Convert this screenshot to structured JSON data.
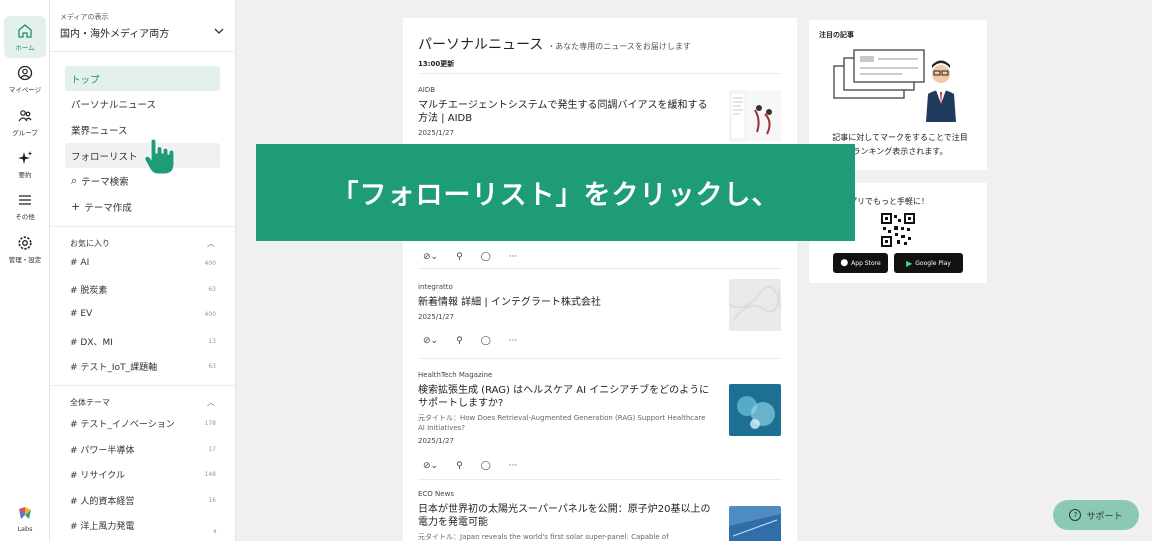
{
  "rail": {
    "items": [
      {
        "label": "ホーム",
        "icon": "home-icon"
      },
      {
        "label": "マイページ",
        "icon": "user-icon"
      },
      {
        "label": "グループ",
        "icon": "group-icon"
      },
      {
        "label": "要約",
        "icon": "sparkle-icon"
      },
      {
        "label": "その他",
        "icon": "menu-icon"
      },
      {
        "label": "管理・設定",
        "icon": "gear-icon"
      }
    ],
    "labs_label": "Labs"
  },
  "sidebar": {
    "media_caption": "メディアの表示",
    "media_value": "国内・海外メディア両方",
    "nav": [
      {
        "label": "トップ"
      },
      {
        "label": "パーソナルニュース"
      },
      {
        "label": "業界ニュース"
      },
      {
        "label": "フォローリスト"
      },
      {
        "label": "テーマ検索"
      },
      {
        "label": "テーマ作成"
      }
    ],
    "favorites_title": "お気に入り",
    "favorites": [
      {
        "name": "AI",
        "count": "400"
      },
      {
        "name": "脱炭素",
        "count": "63"
      },
      {
        "name": "EV",
        "count": "400"
      },
      {
        "name": "DX、MI",
        "count": "13"
      },
      {
        "name": "テスト_IoT_課題軸",
        "count": "63"
      }
    ],
    "themes_title": "全体テーマ",
    "themes": [
      {
        "name": "テスト_イノベーション",
        "count": "178"
      },
      {
        "name": "パワー半導体",
        "count": "17"
      },
      {
        "name": "リサイクル",
        "count": "148"
      },
      {
        "name": "人的資本経営",
        "count": "16"
      },
      {
        "name": "洋上風力発電",
        "count": ""
      }
    ]
  },
  "feed": {
    "title": "パーソナルニュース",
    "subtitle": "・あなた専用のニュースをお届けします",
    "updated": "13:00更新",
    "articles": [
      {
        "source": "AIDB",
        "title": "マルチエージェントシステムで発生する同調バイアスを緩和する方法 | AIDB",
        "date": "2025/1/27"
      },
      {
        "source": "integratto",
        "title": "新着情報 詳細 | インテグラート株式会社",
        "date": "2025/1/27"
      },
      {
        "source": "HealthTech Magazine",
        "title": "検索拡張生成 (RAG) はヘルスケア AI イニシアチブをどのようにサポートしますか?",
        "original": "元タイトル：How Does Retrieval-Augmented Generation (RAG) Support Healthcare AI Initiatives?",
        "date": "2025/1/27"
      },
      {
        "source": "ECO News",
        "title": "日本が世界初の太陽光スーパーパネルを公開：原子炉20基以上の電力を発電可能",
        "original": "元タイトル：Japan reveals the world's first solar super-panel: Capable of"
      }
    ]
  },
  "right": {
    "featured_title": "注目の記事",
    "featured_text_1": "記事に対してマークをすることで注目",
    "featured_text_2": "ランキング表示されます。",
    "app_text": "プリでもっと手軽に！",
    "app_store": "App Store",
    "google_play": "Google Play"
  },
  "banner": {
    "text": "「フォローリスト」をクリックし、"
  },
  "support": {
    "label": "サポート"
  },
  "colors": {
    "accent": "#1e9c78",
    "active_bg": "#e4f1ea",
    "support_bg": "#8cc9b3"
  }
}
